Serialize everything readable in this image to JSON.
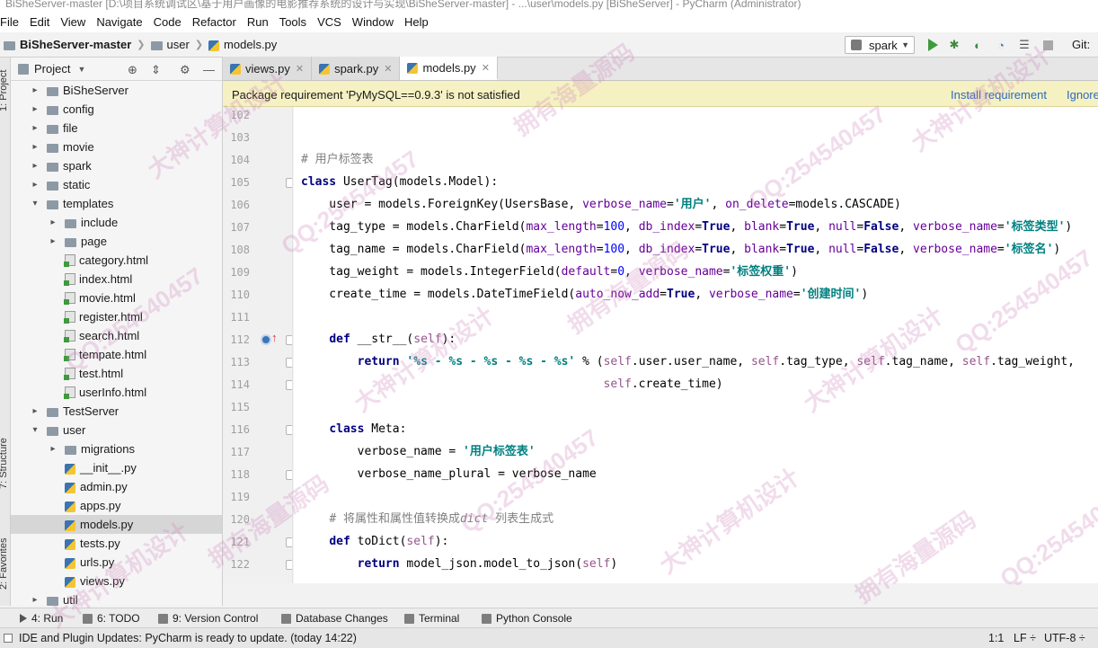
{
  "window": {
    "title": "BiSheServer-master [D:\\项目系统调试区\\基于用户画像的电影推荐系统的设计与实现\\BiSheServer-master] - ...\\user\\models.py [BiSheServer] - PyCharm (Administrator)"
  },
  "menu": [
    "File",
    "Edit",
    "View",
    "Navigate",
    "Code",
    "Refactor",
    "Run",
    "Tools",
    "VCS",
    "Window",
    "Help"
  ],
  "breadcrumb": {
    "project": "BiSheServer-master",
    "folder": "user",
    "file": "models.py"
  },
  "toolbar": {
    "run_config": "spark",
    "git_label": "Git:"
  },
  "left_strip": {
    "project": "1: Project",
    "structure": "7: Structure",
    "favorites": "2: Favorites"
  },
  "project_panel": {
    "title": "Project",
    "items": [
      {
        "label": "BiSheServer",
        "type": "folder",
        "depth": 1,
        "expanded": false
      },
      {
        "label": "config",
        "type": "folder",
        "depth": 1,
        "expanded": false
      },
      {
        "label": "file",
        "type": "folder",
        "depth": 1,
        "expanded": false
      },
      {
        "label": "movie",
        "type": "folder",
        "depth": 1,
        "expanded": false
      },
      {
        "label": "spark",
        "type": "folder",
        "depth": 1,
        "expanded": false
      },
      {
        "label": "static",
        "type": "folder",
        "depth": 1,
        "expanded": false
      },
      {
        "label": "templates",
        "type": "folder",
        "depth": 1,
        "expanded": true
      },
      {
        "label": "include",
        "type": "folder",
        "depth": 2,
        "expanded": false
      },
      {
        "label": "page",
        "type": "folder",
        "depth": 2,
        "expanded": false
      },
      {
        "label": "category.html",
        "type": "html",
        "depth": 2
      },
      {
        "label": "index.html",
        "type": "html",
        "depth": 2
      },
      {
        "label": "movie.html",
        "type": "html",
        "depth": 2
      },
      {
        "label": "register.html",
        "type": "html",
        "depth": 2
      },
      {
        "label": "search.html",
        "type": "html",
        "depth": 2
      },
      {
        "label": "tempate.html",
        "type": "html",
        "depth": 2
      },
      {
        "label": "test.html",
        "type": "html",
        "depth": 2
      },
      {
        "label": "userInfo.html",
        "type": "html",
        "depth": 2
      },
      {
        "label": "TestServer",
        "type": "folder",
        "depth": 1,
        "expanded": false
      },
      {
        "label": "user",
        "type": "folder",
        "depth": 1,
        "expanded": true
      },
      {
        "label": "migrations",
        "type": "folder",
        "depth": 2,
        "expanded": false
      },
      {
        "label": "__init__.py",
        "type": "py",
        "depth": 2
      },
      {
        "label": "admin.py",
        "type": "py",
        "depth": 2
      },
      {
        "label": "apps.py",
        "type": "py",
        "depth": 2
      },
      {
        "label": "models.py",
        "type": "py",
        "depth": 2,
        "selected": true
      },
      {
        "label": "tests.py",
        "type": "py",
        "depth": 2
      },
      {
        "label": "urls.py",
        "type": "py",
        "depth": 2
      },
      {
        "label": "views.py",
        "type": "py",
        "depth": 2
      },
      {
        "label": "util",
        "type": "folder",
        "depth": 1,
        "expanded": false
      }
    ]
  },
  "tabs": [
    {
      "label": "views.py",
      "active": false
    },
    {
      "label": "spark.py",
      "active": false
    },
    {
      "label": "models.py",
      "active": true
    }
  ],
  "banner": {
    "message": "Package requirement 'PyMySQL==0.9.3' is not satisfied",
    "install": "Install requirement",
    "ignore": "Ignore"
  },
  "code_lines": [
    {
      "n": "102",
      "html": ""
    },
    {
      "n": "103",
      "html": ""
    },
    {
      "n": "104",
      "html": "<span class=\"cmt\"># 用户标签表</span>"
    },
    {
      "n": "105",
      "html": "<span class=\"kw\">class</span> UserTag(models.Model):"
    },
    {
      "n": "106",
      "html": "    user = models.ForeignKey(UsersBase, <span class=\"prm\">verbose_name</span>=<span class=\"str\">'用户'</span>, <span class=\"prm\">on_delete</span>=models.CASCADE)"
    },
    {
      "n": "107",
      "html": "    tag_type = models.CharField(<span class=\"prm\">max_length</span>=<span class=\"num\">100</span>, <span class=\"prm\">db_index</span>=<span class=\"kw\">True</span>, <span class=\"prm\">blank</span>=<span class=\"kw\">True</span>, <span class=\"prm\">null</span>=<span class=\"kw\">False</span>, <span class=\"prm\">verbose_name</span>=<span class=\"str\">'标签类型'</span>)"
    },
    {
      "n": "108",
      "html": "    tag_name = models.CharField(<span class=\"prm\">max_length</span>=<span class=\"num\">100</span>, <span class=\"prm\">db_index</span>=<span class=\"kw\">True</span>, <span class=\"prm\">blank</span>=<span class=\"kw\">True</span>, <span class=\"prm\">null</span>=<span class=\"kw\">False</span>, <span class=\"prm\">verbose_name</span>=<span class=\"str\">'标签名'</span>)"
    },
    {
      "n": "109",
      "html": "    tag_weight = models.IntegerField(<span class=\"prm\">default</span>=<span class=\"num\">0</span>, <span class=\"prm\">verbose_name</span>=<span class=\"str\">'标签权重'</span>)"
    },
    {
      "n": "110",
      "html": "    create_time = models.DateTimeField(<span class=\"prm\">auto_now_add</span>=<span class=\"kw\">True</span>, <span class=\"prm\">verbose_name</span>=<span class=\"str\">'创建时间'</span>)"
    },
    {
      "n": "111",
      "html": ""
    },
    {
      "n": "112",
      "html": "    <span class=\"kw\">def</span> __str__(<span class=\"slf\">self</span>):"
    },
    {
      "n": "113",
      "html": "        <span class=\"kw\">return</span> <span class=\"str\">'%s - %s - %s - %s - %s'</span> % (<span class=\"slf\">self</span>.user.user_name, <span class=\"slf\">self</span>.tag_type, <span class=\"slf\">self</span>.tag_name, <span class=\"slf\">self</span>.tag_weight,"
    },
    {
      "n": "114",
      "html": "                                           <span class=\"slf\">self</span>.create_time)"
    },
    {
      "n": "115",
      "html": ""
    },
    {
      "n": "116",
      "html": "    <span class=\"kw\">class</span> Meta:"
    },
    {
      "n": "117",
      "html": "        verbose_name = <span class=\"str\">'用户标签表'</span>"
    },
    {
      "n": "118",
      "html": "        verbose_name_plural = verbose_name"
    },
    {
      "n": "119",
      "html": ""
    },
    {
      "n": "120",
      "html": "    <span class=\"cmt\"># 将属性和属性值转换成<i>dict</i> 列表生成式</span>"
    },
    {
      "n": "121",
      "html": "    <span class=\"kw\">def</span> toDict(<span class=\"slf\">self</span>):"
    },
    {
      "n": "122",
      "html": "        <span class=\"kw\">return</span> model_json.model_to_json(<span class=\"slf\">self</span>)"
    }
  ],
  "bottom_tools": [
    {
      "label": "4: Run",
      "icon": "play-icon"
    },
    {
      "label": "6: TODO",
      "icon": "todo-icon"
    },
    {
      "label": "9: Version Control",
      "icon": "vcs-icon"
    },
    {
      "label": "Database Changes",
      "icon": "database-icon"
    },
    {
      "label": "Terminal",
      "icon": "terminal-icon"
    },
    {
      "label": "Python Console",
      "icon": "python-console-icon"
    }
  ],
  "status": {
    "message": "IDE and Plugin Updates: PyCharm is ready to update. (today 14:22)",
    "position": "1:1",
    "line_sep": "LF",
    "encoding": "UTF-8"
  },
  "watermark": [
    "大神计算机设计",
    "QQ:254540457",
    "拥有海量源码"
  ]
}
